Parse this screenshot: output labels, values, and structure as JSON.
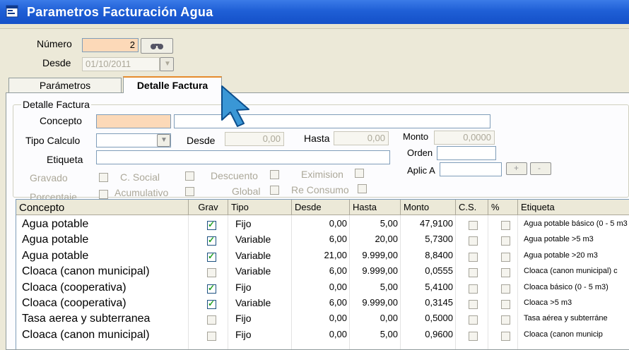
{
  "window": {
    "title": "Parametros Facturación Agua"
  },
  "header": {
    "numero_label": "Número",
    "numero_value": "2",
    "desde_label": "Desde",
    "desde_value": "01/10/2011"
  },
  "tabs": [
    {
      "label": "Parámetros"
    },
    {
      "label": "Detalle Factura"
    }
  ],
  "detalle": {
    "group_title": "Detalle Factura",
    "concepto_label": "Concepto",
    "tipo_calculo_label": "Tipo Calculo",
    "desde_label": "Desde",
    "desde_value": "0,00",
    "hasta_label": "Hasta",
    "hasta_value": "0,00",
    "monto_label": "Monto",
    "monto_value": "0,0000",
    "etiqueta_label": "Etiqueta",
    "orden_label": "Orden",
    "aplic_label": "Aplic A",
    "gravado_label": "Gravado",
    "csocial_label": "C. Social",
    "descuento_label": "Descuento",
    "eximision_label": "Eximision",
    "porcentaje_label": "Porcentaje",
    "acumulativo_label": "Acumulativo",
    "global_label": "Global",
    "reconsumo_label": "Re Consumo"
  },
  "grid": {
    "columns": [
      "Concepto",
      "Grav",
      "Tipo",
      "Desde",
      "Hasta",
      "Monto",
      "C.S.",
      "%",
      "Etiqueta"
    ],
    "rows": [
      {
        "concepto": "Agua potable",
        "grav": true,
        "tipo": "Fijo",
        "desde": "0,00",
        "hasta": "5,00",
        "monto": "47,9100",
        "etiqueta": "Agua potable básico (0 - 5 m3"
      },
      {
        "concepto": "Agua potable",
        "grav": true,
        "tipo": "Variable",
        "desde": "6,00",
        "hasta": "20,00",
        "monto": "5,7300",
        "etiqueta": "Agua potable >5 m3"
      },
      {
        "concepto": "Agua potable",
        "grav": true,
        "tipo": "Variable",
        "desde": "21,00",
        "hasta": "9.999,00",
        "monto": "8,8400",
        "etiqueta": "Agua potable >20 m3"
      },
      {
        "concepto": "Cloaca (canon municipal)",
        "grav": false,
        "tipo": "Variable",
        "desde": "6,00",
        "hasta": "9.999,00",
        "monto": "0,0555",
        "etiqueta": "Cloaca (canon municipal) c"
      },
      {
        "concepto": "Cloaca (cooperativa)",
        "grav": true,
        "tipo": "Fijo",
        "desde": "0,00",
        "hasta": "5,00",
        "monto": "5,4100",
        "etiqueta": "Cloaca básico (0 - 5 m3)"
      },
      {
        "concepto": "Cloaca (cooperativa)",
        "grav": true,
        "tipo": "Variable",
        "desde": "6,00",
        "hasta": "9.999,00",
        "monto": "0,3145",
        "etiqueta": "Cloaca >5 m3"
      },
      {
        "concepto": "Tasa aerea y subterranea",
        "grav": false,
        "tipo": "Fijo",
        "desde": "0,00",
        "hasta": "0,00",
        "monto": "0,5000",
        "etiqueta": "Tasa aérea y subterráne"
      },
      {
        "concepto": "Cloaca (canon municipal)",
        "grav": false,
        "tipo": "Fijo",
        "desde": "0,00",
        "hasta": "5,00",
        "monto": "0,9600",
        "etiqueta": "Cloaca (canon municip"
      }
    ]
  }
}
